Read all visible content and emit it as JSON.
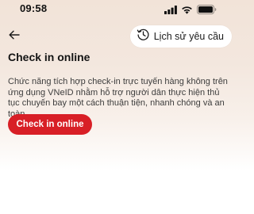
{
  "status_bar": {
    "time": "09:58",
    "icons": [
      "signal-icon",
      "wifi-icon",
      "battery-icon"
    ]
  },
  "header": {
    "back_icon": "arrow-left-icon",
    "history_button": {
      "icon": "clock-history-icon",
      "label": "Lịch sử yêu cầu"
    }
  },
  "main": {
    "title": "Check in online",
    "description": "Chức năng tích hợp check-in trực tuyến hàng không trên ứng dụng VNeID nhằm hỗ trợ người dân thực hiện thủ tục chuyến bay một cách thuận tiện, nhanh chóng và an toàn.",
    "checkin_button_label": "Check in online"
  },
  "colors": {
    "accent": "#d81f26",
    "background_top": "#f2e3d8",
    "background_bottom": "#ffffff"
  }
}
